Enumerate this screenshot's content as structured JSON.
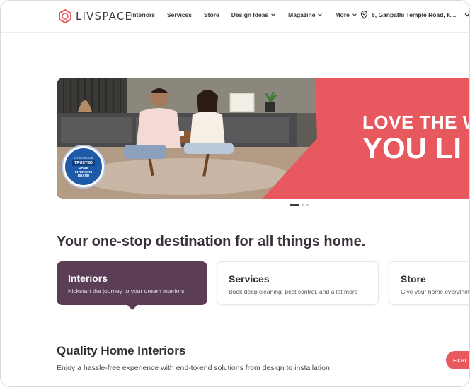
{
  "brand": {
    "logo_text": "LIVSPACE",
    "accent": "#e8585f",
    "dark_accent": "#5b3e55"
  },
  "nav": {
    "items": [
      {
        "label": "Interiors",
        "dropdown": false
      },
      {
        "label": "Services",
        "dropdown": false
      },
      {
        "label": "Store",
        "dropdown": false
      },
      {
        "label": "Design Ideas",
        "dropdown": true
      },
      {
        "label": "Magazine",
        "dropdown": true
      },
      {
        "label": "More",
        "dropdown": true
      }
    ],
    "location": "6, Ganpathi Temple Road, K..."
  },
  "banner": {
    "line1": "LOVE THE W",
    "line2": "YOU LI",
    "badge": {
      "top": "LIVING ROOM",
      "main": "TRUSTED",
      "sub1": "HOME",
      "sub2": "INTERIORS",
      "sub3": "BRAND"
    },
    "slide_count": 3,
    "active_slide": 1
  },
  "headline": "Your one-stop destination for all things home.",
  "cards": [
    {
      "title": "Interiors",
      "desc": "Kickstart the journey to your dream interiors"
    },
    {
      "title": "Services",
      "desc": "Book deep cleaning, pest control, and a lot more"
    },
    {
      "title": "Store",
      "desc": "Give your home everything"
    }
  ],
  "section": {
    "title": "Quality Home Interiors",
    "desc": "Enjoy a hassle-free experience with end-to-end solutions from design to installation",
    "button": "EXPLO"
  }
}
